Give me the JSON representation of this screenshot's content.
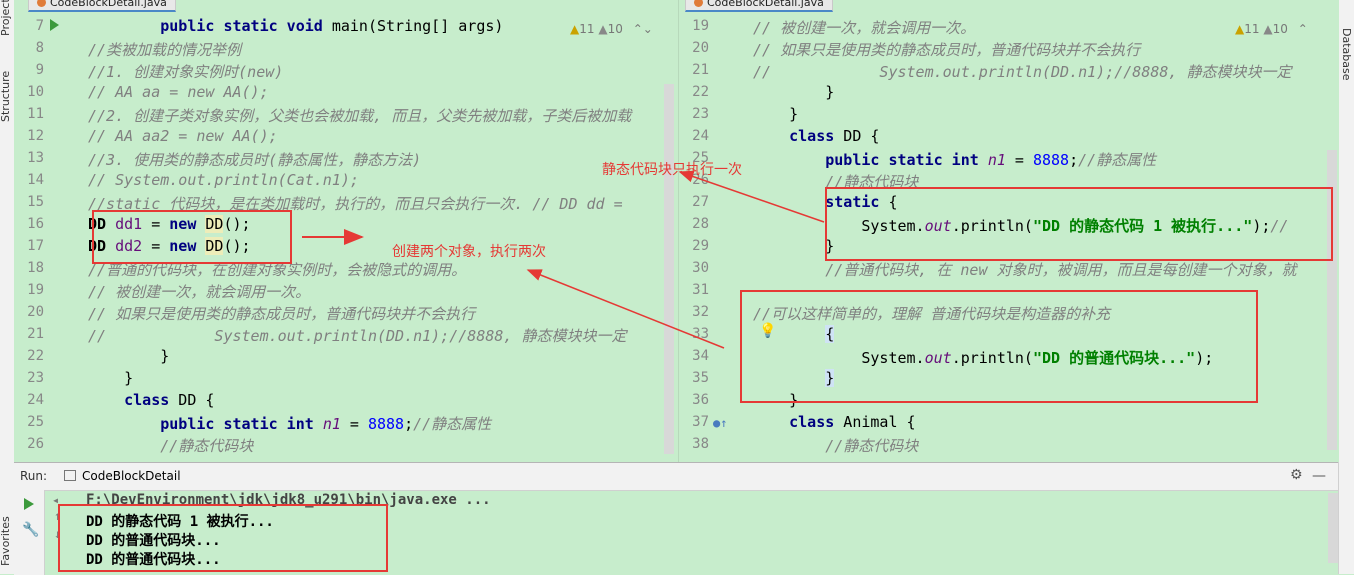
{
  "left_strip": {
    "project": "Project",
    "structure": "Structure",
    "favorites": "Favorites"
  },
  "right_strip": {
    "database": "Database"
  },
  "editor_left": {
    "tab": "CodeBlockDetail.java",
    "hint_warn": "11",
    "hint_weak": "10",
    "lines": [
      {
        "n": "7",
        "html": "        <span class='kw'>public static void</span> main(String[] <span class='fld' style='color:#000;font-style:normal'>args</span>)"
      },
      {
        "n": "8",
        "html": "<span class='cm'>//类被加载的情况举例</span>"
      },
      {
        "n": "9",
        "html": "<span class='cm'>//1. 创建对象实例时(new)</span>"
      },
      {
        "n": "10",
        "html": "<span class='cm'>// AA aa = new AA();</span>"
      },
      {
        "n": "11",
        "html": "<span class='cm'>//2. 创建子类对象实例，父类也会被加载, 而且，父类先被加载，子类后被加载</span>"
      },
      {
        "n": "12",
        "html": "<span class='cm'>// AA aa2 = new AA();</span>"
      },
      {
        "n": "13",
        "html": "<span class='cm'>//3. 使用类的静态成员时(静态属性，静态方法)</span>"
      },
      {
        "n": "14",
        "html": "<span class='cm'>// System.out.println(Cat.n1);</span>"
      },
      {
        "n": "15",
        "html": "<span class='cm'>//static 代码块，是在类加载时，执行的，而且只会执行一次. // DD dd = </span>"
      },
      {
        "n": "16",
        "html": "<b>DD</b> <span class='fld' style='font-style:normal'>dd1</span> = <span class='kw'>new</span> <span class='hl'>DD</span>();"
      },
      {
        "n": "17",
        "html": "<b>DD</b> <span class='fld' style='font-style:normal'>dd2</span> = <span class='kw'>new</span> <span class='hl'>DD</span>();"
      },
      {
        "n": "18",
        "html": "<span class='cm'>//普通的代码块，在创建对象实例时，会被隐式的调用。</span>"
      },
      {
        "n": "19",
        "html": "<span class='cm'>// 被创建一次，就会调用一次。</span>"
      },
      {
        "n": "20",
        "html": "<span class='cm'>// 如果只是使用类的静态成员时，普通代码块并不会执行</span>"
      },
      {
        "n": "21",
        "html": "<span class='cm'>//            System.out.println(DD.n1);//8888, 静态模块块一定</span>"
      },
      {
        "n": "22",
        "html": "        }"
      },
      {
        "n": "23",
        "html": "    }"
      },
      {
        "n": "24",
        "html": "    <span class='kw'>class</span> DD {"
      },
      {
        "n": "25",
        "html": "        <span class='kw'>public static int</span> <span class='fld'>n1</span> = <span class='num'>8888</span>;<span class='cm'>//静态属性</span>"
      },
      {
        "n": "26",
        "html": "        <span class='cm'>//静态代码块</span>"
      }
    ]
  },
  "editor_right": {
    "tab": "CodeBlockDetail.java",
    "hint_warn": "11",
    "hint_weak": "10",
    "lines": [
      {
        "n": "19",
        "html": "<span class='cm'>// 被创建一次，就会调用一次。</span>"
      },
      {
        "n": "20",
        "html": "<span class='cm'>// 如果只是使用类的静态成员时，普通代码块并不会执行</span>"
      },
      {
        "n": "21",
        "html": "<span class='cm'>//            System.out.println(DD.n1);//8888, 静态模块块一定</span>"
      },
      {
        "n": "22",
        "html": "        }"
      },
      {
        "n": "23",
        "html": "    }"
      },
      {
        "n": "24",
        "html": "    <span class='kw'>class</span> DD {"
      },
      {
        "n": "25",
        "html": "        <span class='kw'>public static int</span> <span class='fld'>n1</span> = <span class='num'>8888</span>;<span class='cm'>//静态属性</span>"
      },
      {
        "n": "26",
        "html": "        <span class='cm'>//静态代码块</span>"
      },
      {
        "n": "27",
        "html": "        <span class='kw'>static</span> {"
      },
      {
        "n": "28",
        "html": "            System.<span class='fld'>out</span>.println(<span class='str'>\"DD 的静态代码 1 被执行...\"</span>);<span class='cm'>//</span>"
      },
      {
        "n": "29",
        "html": "        }"
      },
      {
        "n": "30",
        "html": "        <span class='cm'>//普通代码块, 在 new 对象时，被调用，而且是每创建一个对象，就</span>"
      },
      {
        "n": "31",
        "html": ""
      },
      {
        "n": "32",
        "html": "<span class='cm'>//可以这样简单的，理解 普通代码块是构造器的补充</span>"
      },
      {
        "n": "33",
        "html": "        <span style='background:#cfe3f5'>{</span>"
      },
      {
        "n": "34",
        "html": "            System.<span class='fld'>out</span>.println(<span class='str'>\"DD 的普通代码块...\"</span>);"
      },
      {
        "n": "35",
        "html": "        <span style='background:#cfe3f5'>}</span>"
      },
      {
        "n": "36",
        "html": "    }"
      },
      {
        "n": "37",
        "html": "    <span class='kw'>class</span> Animal {"
      },
      {
        "n": "38",
        "html": "        <span class='cm'>//静态代码块</span>"
      }
    ]
  },
  "run_panel": {
    "label": "Run:",
    "config_tab": "CodeBlockDetail",
    "command": "F:\\DevEnvironment\\jdk\\jdk8_u291\\bin\\java.exe ...",
    "output": [
      "DD 的静态代码 1 被执行...",
      "DD 的普通代码块...",
      "DD 的普通代码块..."
    ]
  },
  "annotations": {
    "static_once": "静态代码块只执行一次",
    "two_objects": "创建两个对象，执行两次"
  },
  "colors": {
    "editor_bg": "#c7edcc",
    "annotation_red": "#e53935",
    "keyword": "#000080",
    "string": "#008000",
    "comment": "#808080"
  }
}
